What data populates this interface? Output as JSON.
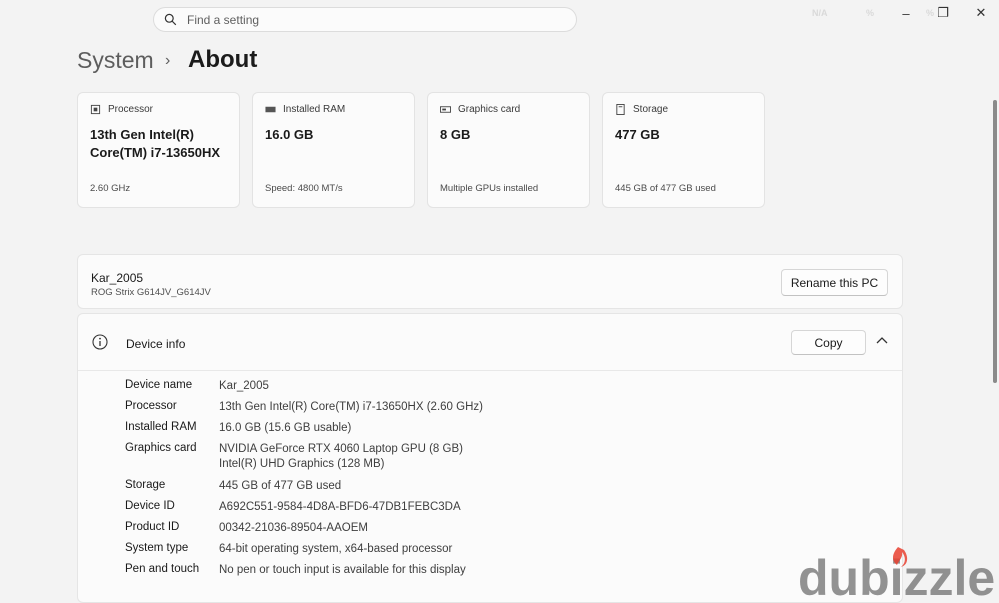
{
  "search": {
    "placeholder": "Find a setting"
  },
  "window_controls": {
    "minimize": "–",
    "restore": "❐",
    "close": "✕"
  },
  "tray": [
    "N/A",
    "%",
    "%"
  ],
  "breadcrumb": {
    "parent": "System",
    "separator": "›",
    "current": "About"
  },
  "cards": [
    {
      "icon": "processor-icon",
      "label": "Processor",
      "value": "13th Gen Intel(R) Core(TM) i7-13650HX",
      "sub": "2.60 GHz"
    },
    {
      "icon": "ram-icon",
      "label": "Installed RAM",
      "value": "16.0 GB",
      "sub": "Speed: 4800 MT/s"
    },
    {
      "icon": "graphics-card-icon",
      "label": "Graphics card",
      "value": "8 GB",
      "sub": "Multiple GPUs installed"
    },
    {
      "icon": "storage-icon",
      "label": "Storage",
      "value": "477 GB",
      "sub": "445 GB of 477 GB used"
    }
  ],
  "pc": {
    "name": "Kar_2005",
    "model": "ROG Strix G614JV_G614JV",
    "rename_label": "Rename this PC"
  },
  "device_info": {
    "title": "Device info",
    "copy_label": "Copy",
    "rows": [
      {
        "label": "Device name",
        "value": "Kar_2005"
      },
      {
        "label": "Processor",
        "value": "13th Gen Intel(R) Core(TM) i7-13650HX (2.60 GHz)"
      },
      {
        "label": "Installed RAM",
        "value": "16.0 GB (15.6 GB usable)"
      },
      {
        "label": "Graphics card",
        "value": "NVIDIA GeForce RTX 4060 Laptop GPU (8 GB)",
        "value2": "Intel(R) UHD Graphics (128 MB)"
      },
      {
        "label": "Storage",
        "value": "445 GB of 477 GB used"
      },
      {
        "label": "Device ID",
        "value": "A692C551-9584-4D8A-BFD6-47DB1FEBC3DA"
      },
      {
        "label": "Product ID",
        "value": "00342-21036-89504-AAOEM"
      },
      {
        "label": "System type",
        "value": "64-bit operating system, x64-based processor"
      },
      {
        "label": "Pen and touch",
        "value": "No pen or touch input is available for this display"
      }
    ]
  },
  "watermark": {
    "text": "dubizzle",
    "color": "#6f6f6f",
    "flame_color": "#e8402f"
  }
}
